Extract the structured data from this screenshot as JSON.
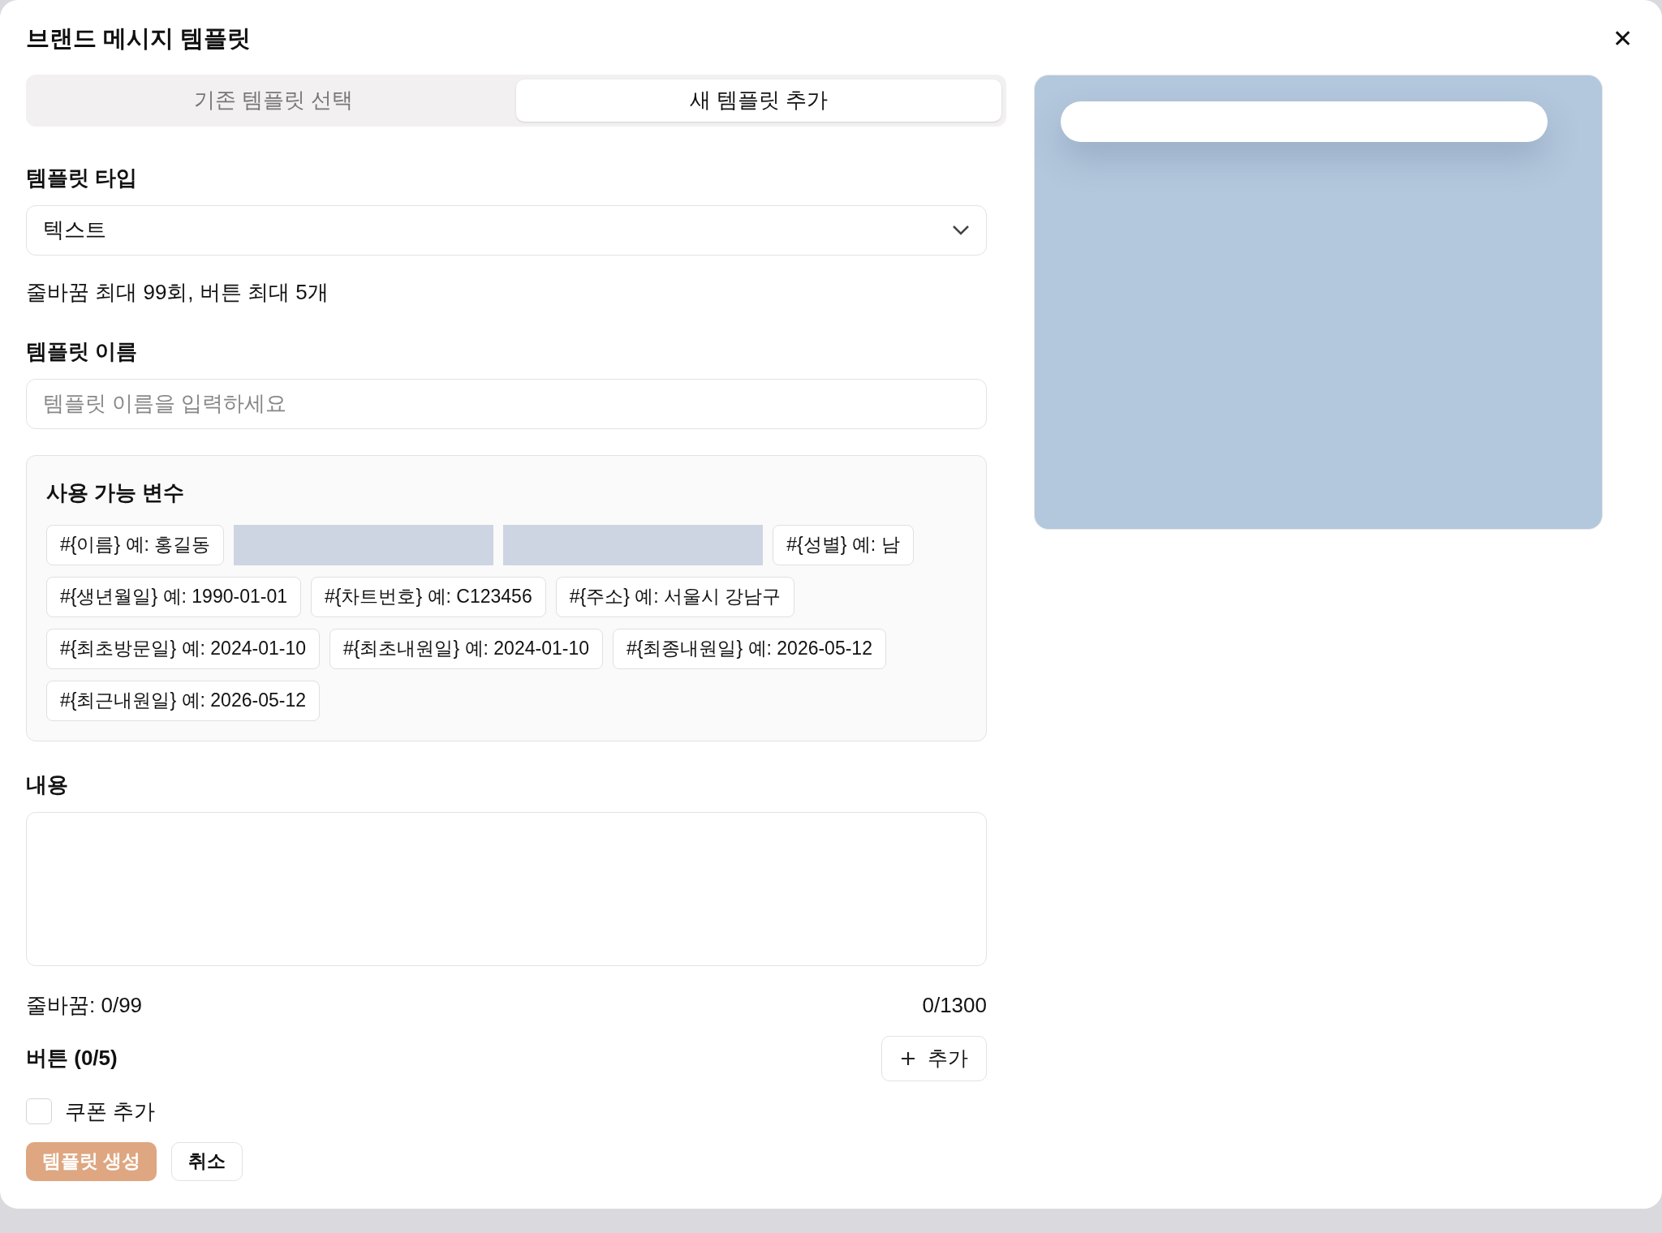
{
  "dialog": {
    "title": "브랜드 메시지 템플릿",
    "close": "✕"
  },
  "tabs": [
    {
      "label": "기존 템플릿 선택",
      "selected": false
    },
    {
      "label": "새 템플릿 추가",
      "selected": true
    }
  ],
  "template_type": {
    "label": "템플릿 타입",
    "value": "텍스트",
    "hint": "줄바꿈 최대 99회, 버튼 최대 5개"
  },
  "template_name": {
    "label": "템플릿 이름",
    "placeholder": "템플릿 이름을 입력하세요"
  },
  "variables": {
    "title": "사용 가능 변수",
    "items": [
      {
        "kind": "chip",
        "text": "#{이름} 예: 홍길동"
      },
      {
        "kind": "blank"
      },
      {
        "kind": "blank"
      },
      {
        "kind": "chip",
        "text": "#{성별} 예: 남"
      },
      {
        "kind": "chip",
        "text": "#{생년월일} 예: 1990-01-01"
      },
      {
        "kind": "chip",
        "text": "#{차트번호} 예: C123456"
      },
      {
        "kind": "chip",
        "text": "#{주소} 예: 서울시 강남구"
      },
      {
        "kind": "chip",
        "text": "#{최초방문일} 예: 2024-01-10"
      },
      {
        "kind": "chip",
        "text": "#{최초내원일} 예: 2024-01-10"
      },
      {
        "kind": "chip",
        "text": "#{최종내원일} 예: 2026-05-12"
      },
      {
        "kind": "chip",
        "text": "#{최근내원일} 예: 2026-05-12"
      }
    ]
  },
  "content": {
    "label": "내용",
    "line_breaks": "줄바꿈: 0/99",
    "char_count": "0/1300"
  },
  "buttons_section": {
    "label": "버튼 (0/5)",
    "add": "추가"
  },
  "coupon": {
    "label": "쿠폰 추가",
    "checked": false
  },
  "actions": [
    {
      "kind": "primary",
      "label": "템플릿 생성"
    },
    {
      "kind": "secondary",
      "label": "취소"
    }
  ]
}
